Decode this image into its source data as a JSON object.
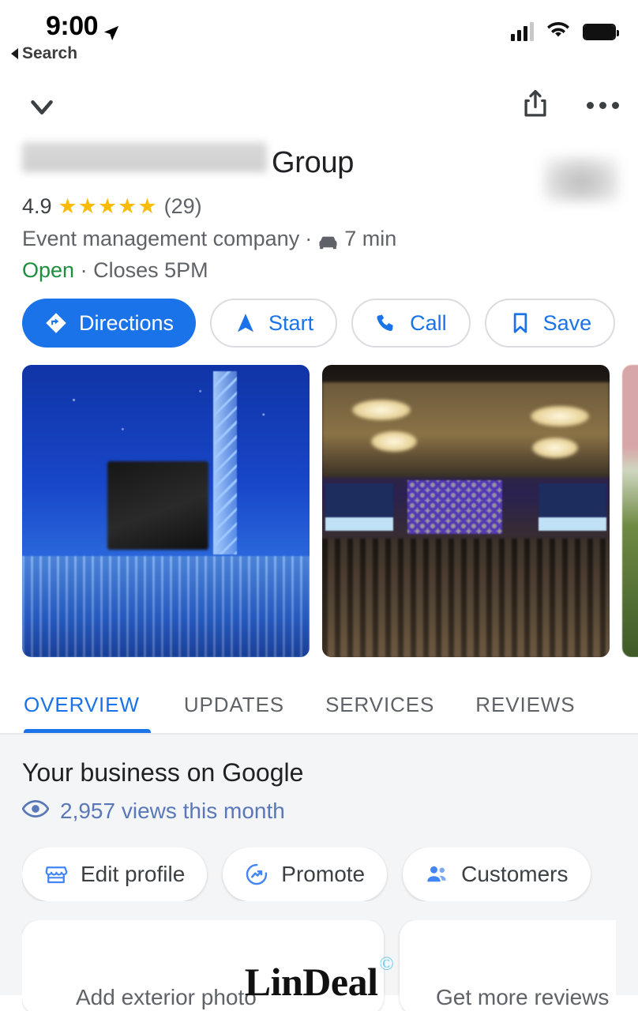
{
  "status_bar": {
    "time": "9:00",
    "location_arrow_icon": "location-arrow-icon",
    "back_label": "Search",
    "signal_icon": "cellular-signal-icon",
    "wifi_icon": "wifi-icon",
    "battery_icon": "battery-full-icon"
  },
  "nav": {
    "collapse_icon": "chevron-down-icon",
    "share_icon": "share-icon",
    "overflow_icon": "more-options-icon"
  },
  "business": {
    "name_redacted": "",
    "name_visible": "Group",
    "logo": "blurred-business-logo",
    "rating": "4.9",
    "stars": "★★★★★",
    "review_count": "(29)",
    "category": "Event management company",
    "drive_separator": "·",
    "drive_icon": "car-icon",
    "drive_time": "7 min",
    "open_status": "Open",
    "hours_separator": "·",
    "closing_time": "Closes 5PM"
  },
  "actions": [
    {
      "label": "Directions",
      "icon": "directions-icon",
      "style": "primary"
    },
    {
      "label": "Start",
      "icon": "navigation-arrow-icon",
      "style": "outline"
    },
    {
      "label": "Call",
      "icon": "phone-icon",
      "style": "outline"
    },
    {
      "label": "Save",
      "icon": "bookmark-icon",
      "style": "outline"
    }
  ],
  "photos": [
    {
      "alt": "blue-lit-stage-with-mixing-console"
    },
    {
      "alt": "ballroom-conference-with-audience"
    },
    {
      "alt": "outdoor-event-photo-partial"
    }
  ],
  "tabs": [
    {
      "label": "OVERVIEW",
      "active": true
    },
    {
      "label": "UPDATES",
      "active": false
    },
    {
      "label": "SERVICES",
      "active": false
    },
    {
      "label": "REVIEWS",
      "active": false
    }
  ],
  "overview": {
    "section_title": "Your business on Google",
    "views_icon": "eye-icon",
    "views_text": "2,957 views this month",
    "chips": [
      {
        "label": "Edit profile",
        "icon": "storefront-icon"
      },
      {
        "label": "Promote",
        "icon": "promote-trending-icon"
      },
      {
        "label": "Customers",
        "icon": "people-icon"
      }
    ],
    "cards": [
      {
        "label": "Add exterior photo"
      },
      {
        "label": "Get more reviews"
      }
    ]
  },
  "watermark": {
    "text": "LinDeal",
    "mark": "©"
  },
  "colors": {
    "accent_blue": "#1a73e8",
    "star_gold": "#fabb05",
    "open_green": "#1e8e3e",
    "text_primary": "#202124",
    "text_secondary": "#5f6368",
    "content_bg": "#f4f5f7"
  }
}
